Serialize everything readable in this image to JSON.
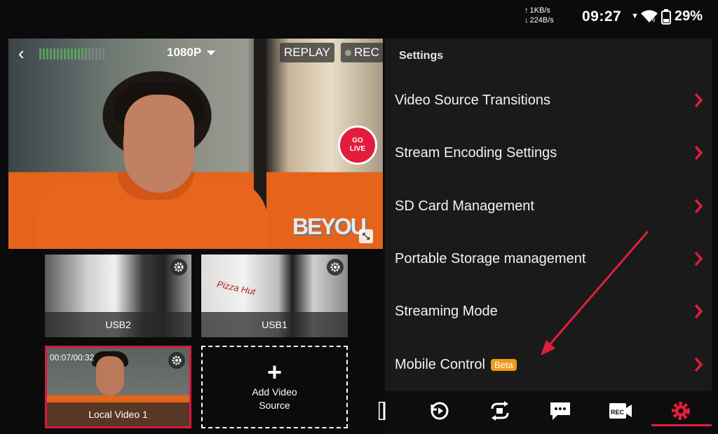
{
  "status_bar": {
    "net_up": "1KB/s",
    "net_down": "224B/s",
    "time": "09:27",
    "wifi_badge": "6",
    "battery": "29%"
  },
  "preview": {
    "resolution": "1080P",
    "replay_label": "REPLAY",
    "rec_label": "REC",
    "go_live_line1": "GO",
    "go_live_line2": "LIVE",
    "watermark": "BEYOU"
  },
  "sources": [
    {
      "label": "USB2"
    },
    {
      "label": "USB1"
    },
    {
      "label": "Local Video 1",
      "time": "00:07/00:32"
    }
  ],
  "add_source": {
    "line1": "Add Video",
    "line2": "Source"
  },
  "settings": {
    "title": "Settings",
    "items": [
      {
        "label": "Video Source Transitions"
      },
      {
        "label": "Stream Encoding Settings"
      },
      {
        "label": "SD Card Management"
      },
      {
        "label": "Portable Storage management"
      },
      {
        "label": "Streaming Mode"
      },
      {
        "label": "Mobile Control",
        "badge": "Beta"
      }
    ]
  },
  "toolbar": {
    "icons": [
      "sd-card-icon",
      "replay-icon",
      "switch-camera-icon",
      "chat-icon",
      "rec-icon",
      "settings-gear-icon"
    ],
    "rec_text": "REC",
    "active": "settings-gear-icon"
  },
  "colors": {
    "accent": "#e31c3d",
    "beta": "#f39a16",
    "panel": "#1a1a1a"
  }
}
